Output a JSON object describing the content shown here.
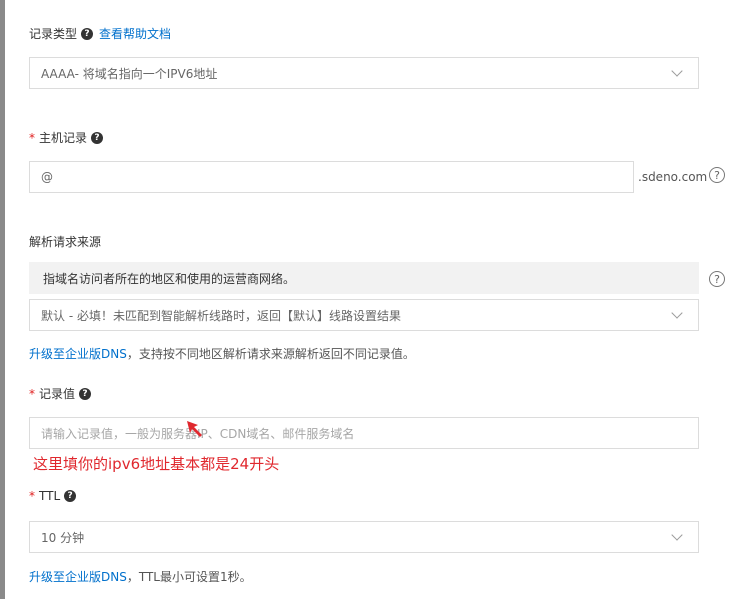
{
  "record_type": {
    "label": "记录类型",
    "help_link": "查看帮助文档",
    "value": "AAAA- 将域名指向一个IPV6地址"
  },
  "host_record": {
    "required_mark": "*",
    "label": "主机记录",
    "value": "@",
    "suffix": ".sdeno.com"
  },
  "resolve_source": {
    "label": "解析请求来源",
    "info": "指域名访问者所在的地区和使用的运营商网络。",
    "value": "默认 - 必填！未匹配到智能解析线路时，返回【默认】线路设置结果",
    "hint_link": "升级至企业版DNS",
    "hint_text": "，支持按不同地区解析请求来源解析返回不同记录值。"
  },
  "record_value": {
    "required_mark": "*",
    "label": "记录值",
    "placeholder": "请输入记录值，一般为服务器IP、CDN域名、邮件服务域名",
    "annotation": "这里填你的ipv6地址基本都是24开头"
  },
  "ttl": {
    "required_mark": "*",
    "label": "TTL",
    "value": "10 分钟",
    "hint_link": "升级至企业版DNS",
    "hint_text": "，TTL最小可设置1秒。"
  },
  "icons": {
    "question": "?",
    "help_circle": "?"
  },
  "colors": {
    "link": "#0070cc",
    "required": "#e02020",
    "annotation": "#e0282e",
    "border": "#dcdcdc"
  }
}
